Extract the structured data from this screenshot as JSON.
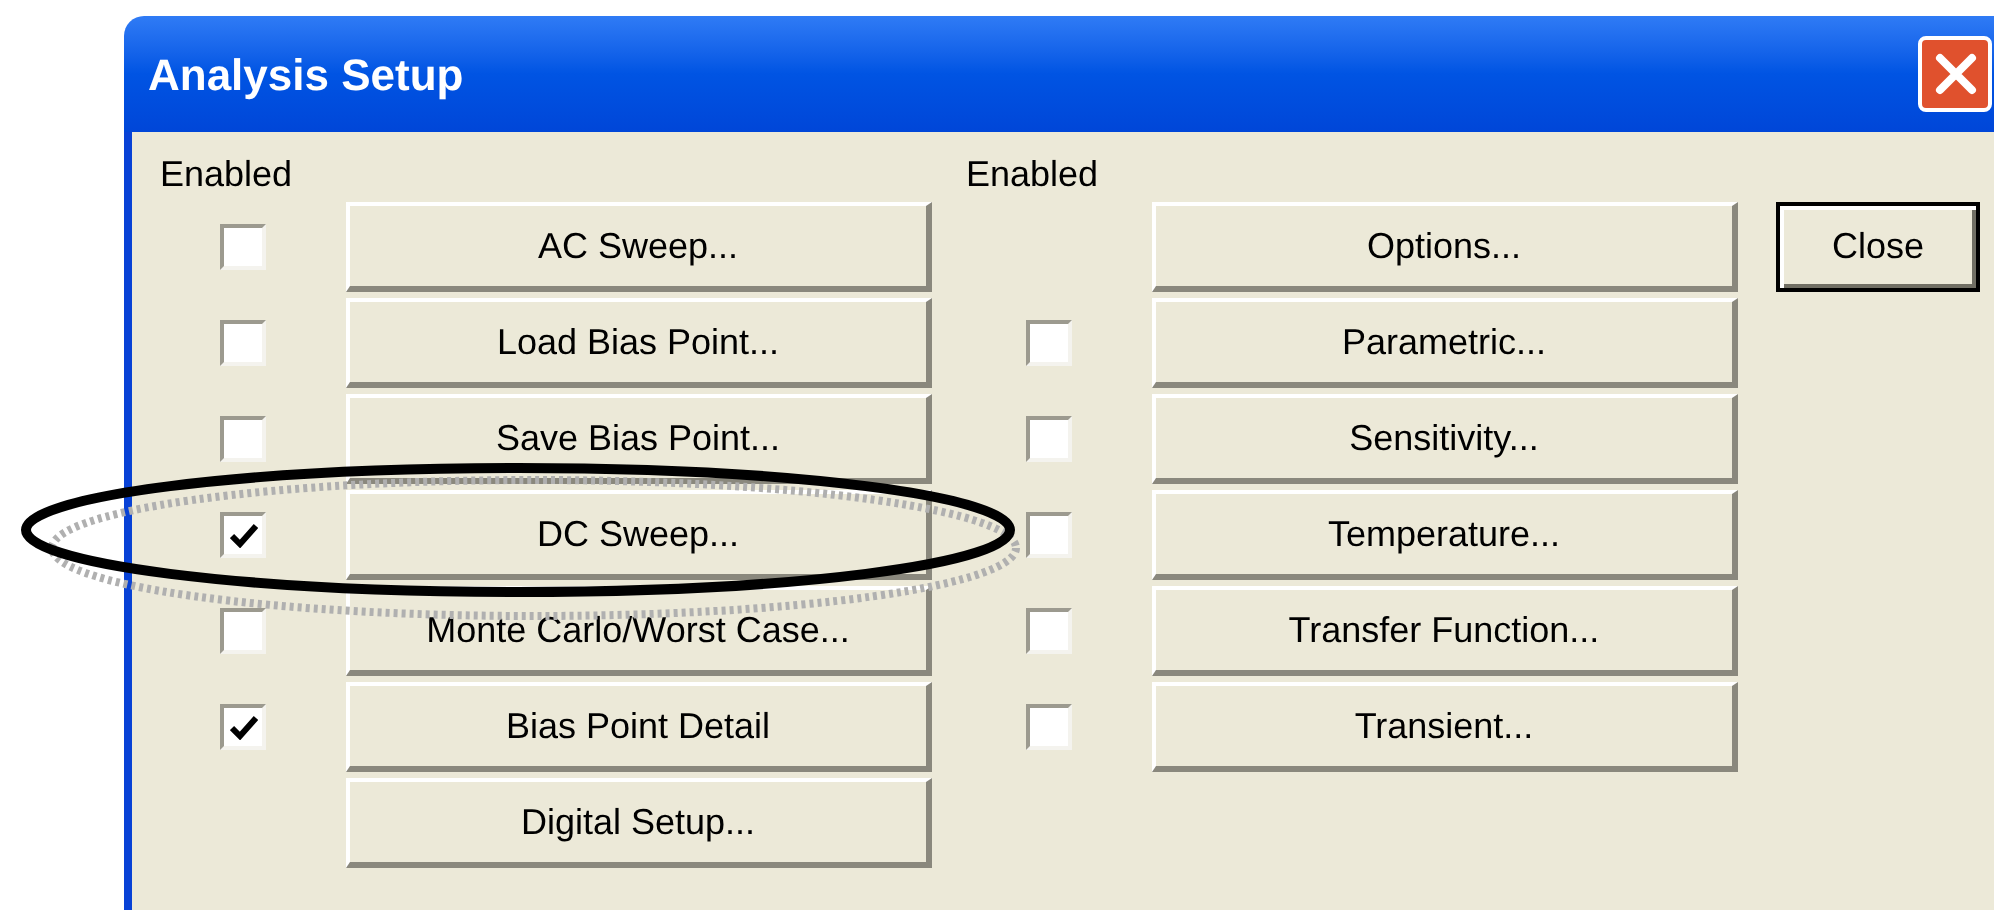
{
  "window": {
    "title": "Analysis Setup"
  },
  "left_column": {
    "header": "Enabled",
    "rows": [
      {
        "kind": "checkbox_row",
        "label": "AC Sweep...",
        "checked": false
      },
      {
        "kind": "checkbox_row",
        "label": "Load Bias Point...",
        "checked": false
      },
      {
        "kind": "checkbox_row",
        "label": "Save Bias Point...",
        "checked": false
      },
      {
        "kind": "checkbox_row",
        "label": "DC Sweep...",
        "checked": true
      },
      {
        "kind": "checkbox_row",
        "label": "Monte Carlo/Worst Case...",
        "checked": false
      },
      {
        "kind": "checkbox_row",
        "label": "Bias Point Detail",
        "checked": true
      },
      {
        "kind": "button_only",
        "label": "Digital Setup..."
      }
    ]
  },
  "right_column": {
    "header": "Enabled",
    "rows": [
      {
        "kind": "button_only",
        "label": "Options..."
      },
      {
        "kind": "checkbox_row",
        "label": "Parametric...",
        "checked": false
      },
      {
        "kind": "checkbox_row",
        "label": "Sensitivity...",
        "checked": false
      },
      {
        "kind": "checkbox_row",
        "label": "Temperature...",
        "checked": false
      },
      {
        "kind": "checkbox_row",
        "label": "Transfer Function...",
        "checked": false
      },
      {
        "kind": "checkbox_row",
        "label": "Transient...",
        "checked": false
      }
    ]
  },
  "close_button": {
    "label": "Close",
    "default": true
  }
}
